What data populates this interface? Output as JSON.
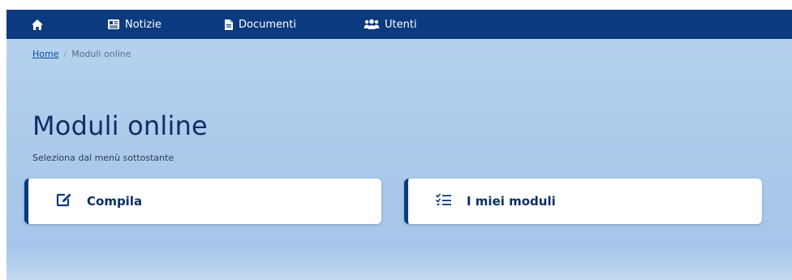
{
  "nav": {
    "items": [
      {
        "icon": "home-icon",
        "label": ""
      },
      {
        "icon": "newspaper-icon",
        "label": "Notizie"
      },
      {
        "icon": "document-icon",
        "label": "Documenti"
      },
      {
        "icon": "users-icon",
        "label": "Utenti"
      }
    ]
  },
  "breadcrumb": {
    "home": "Home",
    "separator": "/",
    "current": "Moduli online"
  },
  "page": {
    "title": "Moduli online",
    "subtitle": "Seleziona dal menù sottostante"
  },
  "cards": [
    {
      "icon": "edit-icon",
      "label": "Compila"
    },
    {
      "icon": "checklist-icon",
      "label": "I miei moduli"
    }
  ],
  "colors": {
    "navbar": "#0c3a7f",
    "hero": "#a9c9ea",
    "title": "#0c2f66"
  }
}
